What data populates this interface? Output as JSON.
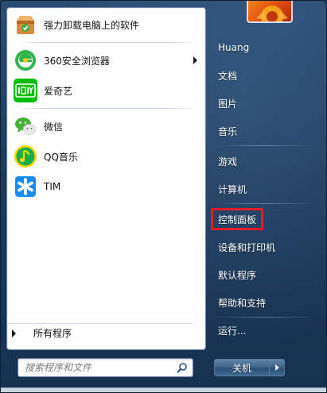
{
  "programs": [
    {
      "label": "强力卸载电脑上的软件",
      "icon": "uninstall-box-icon",
      "has_submenu": false
    },
    {
      "label": "360安全浏览器",
      "icon": "360-browser-icon",
      "has_submenu": true
    },
    {
      "label": "爱奇艺",
      "icon": "iqiyi-icon",
      "has_submenu": false
    },
    {
      "label": "微信",
      "icon": "wechat-icon",
      "has_submenu": false
    },
    {
      "label": "QQ音乐",
      "icon": "qq-music-icon",
      "has_submenu": false
    },
    {
      "label": "TIM",
      "icon": "tim-icon",
      "has_submenu": false
    }
  ],
  "all_programs_label": "所有程序",
  "search": {
    "placeholder": "搜索程序和文件",
    "value": ""
  },
  "right_menu": {
    "user": "Huang",
    "documents": "文档",
    "pictures": "图片",
    "music": "音乐",
    "games": "游戏",
    "computer": "计算机",
    "control_panel": "控制面板",
    "devices_printers": "设备和打印机",
    "default_programs": "默认程序",
    "help_support": "帮助和支持",
    "run": "运行..."
  },
  "shutdown_label": "关机",
  "colors": {
    "highlight_border": "#e01e2a",
    "menu_blue": "#1d3a5a",
    "iqiyi_green": "#00be06",
    "qq_music_yellow": "#ffd400",
    "tim_blue": "#1a8cf0"
  }
}
